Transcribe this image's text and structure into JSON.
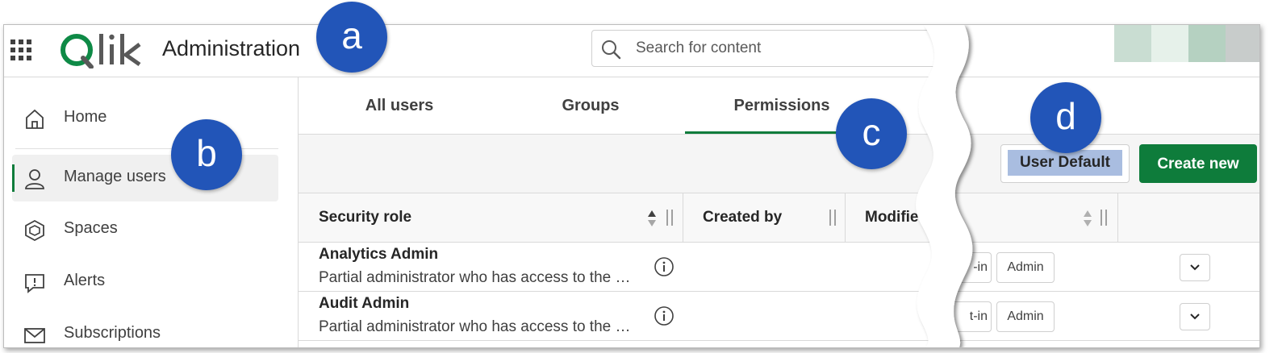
{
  "header": {
    "app_title": "Administration",
    "search_placeholder": "Search for content",
    "swatch_colors": [
      "#c9ddd2",
      "#e6f1ea",
      "#b5d1c1",
      "#c8cccb"
    ]
  },
  "sidebar": {
    "items": [
      {
        "label": "Home",
        "icon": "home-icon",
        "active": false
      },
      {
        "label": "Manage users",
        "icon": "user-icon",
        "active": true
      },
      {
        "label": "Spaces",
        "icon": "spaces-icon",
        "active": false
      },
      {
        "label": "Alerts",
        "icon": "alert-icon",
        "active": false
      },
      {
        "label": "Subscriptions",
        "icon": "mail-icon",
        "active": false
      }
    ]
  },
  "tabs": [
    "All users",
    "Groups",
    "Permissions"
  ],
  "active_tab": "Permissions",
  "toolbar": {
    "user_default_label": "User Default",
    "create_new_label": "Create new"
  },
  "table": {
    "columns": [
      "Security role",
      "Created by",
      "Modifie"
    ],
    "rows": [
      {
        "name": "Analytics Admin",
        "description": "Partial administrator who has access to the …",
        "type_partial": "-in",
        "tag": "Admin"
      },
      {
        "name": "Audit Admin",
        "description": "Partial administrator who has access to the …",
        "type_partial": "t-in",
        "tag": "Admin"
      }
    ]
  },
  "callouts": [
    "a",
    "b",
    "c",
    "d"
  ],
  "colors": {
    "accent_green": "#0e7c3b",
    "callout_blue": "#2255b8",
    "highlight": "#a9bde0"
  }
}
